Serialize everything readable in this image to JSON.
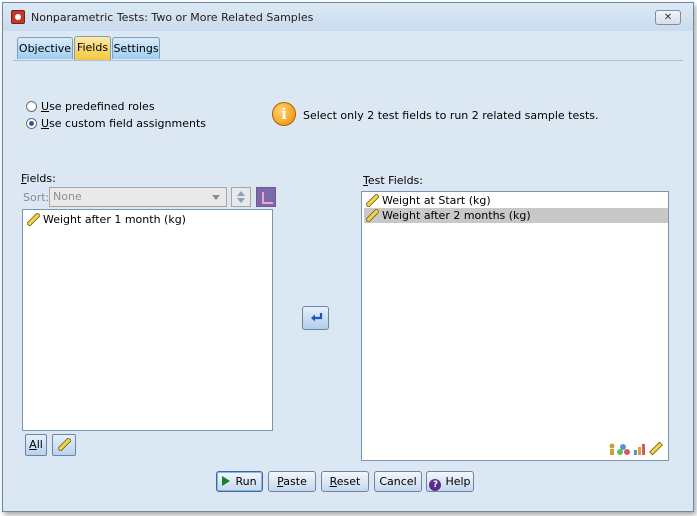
{
  "window": {
    "title": "Nonparametric Tests: Two or More Related Samples",
    "close_label": "✕"
  },
  "tabs": [
    {
      "label": "Objective"
    },
    {
      "label": "Fields"
    },
    {
      "label": "Settings"
    }
  ],
  "roles": {
    "option1_first": "U",
    "option1_rest": "se predefined roles",
    "option2_first": "U",
    "option2_rest": "se custom field assignments",
    "selected": "Use custom field assignments"
  },
  "info": {
    "icon_text": "i",
    "message": "Select only 2 test fields to run 2 related sample tests."
  },
  "fields_panel": {
    "label_first": "F",
    "label_rest": "ields:",
    "sort_label": "Sort:",
    "sort_value": "None",
    "items": [
      "Weight after 1 month (kg)"
    ],
    "all_button_first": "A",
    "all_button_rest": "ll"
  },
  "test_fields_panel": {
    "label_first": "T",
    "label_rest": "est Fields:",
    "items": [
      "Weight at Start (kg)",
      "Weight after 2 months (kg)"
    ],
    "selected_item": "Weight after 2 months (kg)"
  },
  "buttons": {
    "run": "Run",
    "paste_first": "P",
    "paste_rest": "aste",
    "reset_first": "R",
    "reset_rest": "eset",
    "cancel": "Cancel",
    "help": "Help"
  },
  "colors": {
    "accent": "#f6c640",
    "selection": "#c8c8c8",
    "background": "#dbe8f4"
  }
}
